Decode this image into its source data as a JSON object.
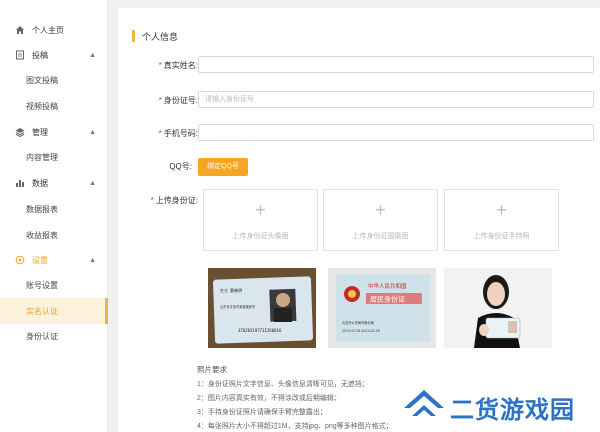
{
  "sidebar": {
    "home": "个人主页",
    "submit": {
      "label": "投稿",
      "items": [
        "图文投稿",
        "视频投稿"
      ]
    },
    "manage": {
      "label": "管理",
      "items": [
        "内容管理"
      ]
    },
    "data": {
      "label": "数据",
      "items": [
        "数据报表",
        "收益报表"
      ]
    },
    "settings": {
      "label": "设置",
      "items": [
        "账号设置",
        "实名认证",
        "身份认证"
      ]
    }
  },
  "main": {
    "title": "个人信息",
    "fields": {
      "name": {
        "label": "真实姓名:",
        "value": "",
        "placeholder": ""
      },
      "id_number": {
        "label": "身份证号:",
        "value": "",
        "placeholder": "请输入身份证号"
      },
      "phone": {
        "label": "手机号码:",
        "value": "",
        "placeholder": ""
      }
    },
    "qq": {
      "label": "QQ号:",
      "button": "绑定QQ号"
    },
    "upload": {
      "label": "上传身份证:",
      "boxes": [
        "上传身份证头像面",
        "上传身份证国徽面",
        "上传身份证手持照"
      ]
    },
    "samples": {
      "front": {
        "name": "黄晓明",
        "address": "山东省青岛市某某路某号",
        "number": "370203197711260016"
      },
      "back": {
        "country": "中华人民共和国",
        "title": "居民身份证",
        "authority": "青岛市公安局市南分局",
        "valid": "2013.02.26-2023.02.26"
      }
    },
    "requirements": {
      "title": "照片要求",
      "items": [
        "1：身份证照片文字信息、头像信息清晰可见，无遮挡；",
        "2：图片内容真实有效，不得涂改或后期编辑；",
        "3：手持身份证照片请确保手臂完整露出；",
        "4：每张照片大小不得超过1M，支持jpg、png等多种图片格式；"
      ]
    }
  },
  "watermark": "二货游戏园",
  "colors": {
    "accent": "#f5a623",
    "active_bg": "#fdf3dc",
    "required": "#e53935",
    "watermark": "#2b73c4"
  }
}
